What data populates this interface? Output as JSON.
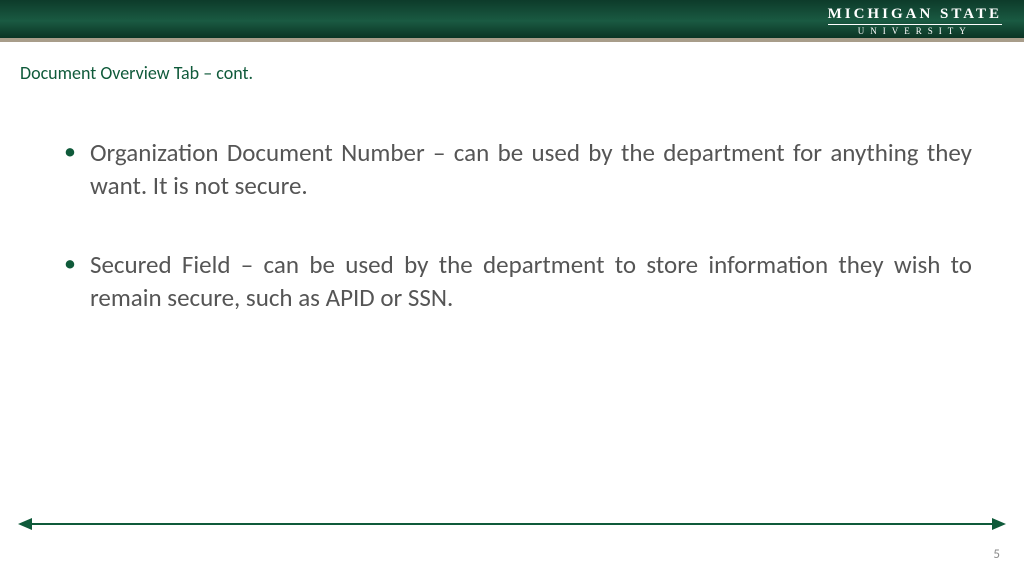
{
  "header": {
    "logo_line1": "MICHIGAN STATE",
    "logo_line2": "UNIVERSITY"
  },
  "title": "Document Overview Tab – cont.",
  "bullets": [
    "Organization Document Number – can be used by the department for anything they want.  It is not secure.",
    "Secured Field – can be used by the department to store information they wish to remain secure, such as APID or SSN."
  ],
  "page_number": "5",
  "colors": {
    "accent": "#0f5a3a"
  }
}
